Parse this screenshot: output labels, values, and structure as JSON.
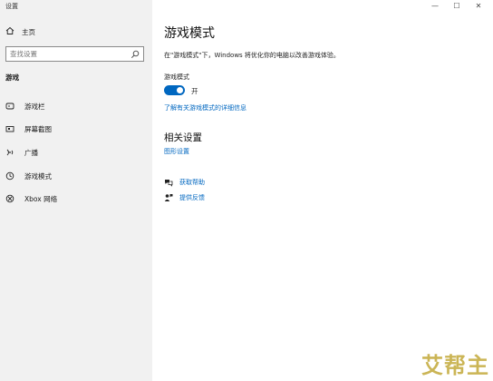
{
  "window": {
    "title": "设置",
    "controls": {
      "minimize": "—",
      "maximize": "☐",
      "close": "✕"
    }
  },
  "sidebar": {
    "home_label": "主页",
    "search": {
      "placeholder": "查找设置",
      "value": ""
    },
    "section_label": "游戏",
    "items": [
      {
        "label": "游戏栏",
        "icon": "game-bar-icon"
      },
      {
        "label": "屏幕截图",
        "icon": "captures-icon"
      },
      {
        "label": "广播",
        "icon": "broadcasting-icon"
      },
      {
        "label": "游戏模式",
        "icon": "game-mode-icon"
      },
      {
        "label": "Xbox 网络",
        "icon": "xbox-icon"
      }
    ]
  },
  "main": {
    "title": "游戏模式",
    "description": "在\"游戏模式\"下，Windows 将优化你的电脑以改善游戏体验。",
    "toggle_label": "游戏模式",
    "toggle_state": "开",
    "toggle_on": true,
    "learn_more_link": "了解有关游戏模式的详细信息",
    "related_title": "相关设置",
    "graphics_link": "图形设置",
    "help_link": "获取帮助",
    "feedback_link": "提供反馈"
  },
  "colors": {
    "accent": "#0067c0",
    "sidebar_bg": "#f1f1f1"
  },
  "watermark": "艾帮主"
}
